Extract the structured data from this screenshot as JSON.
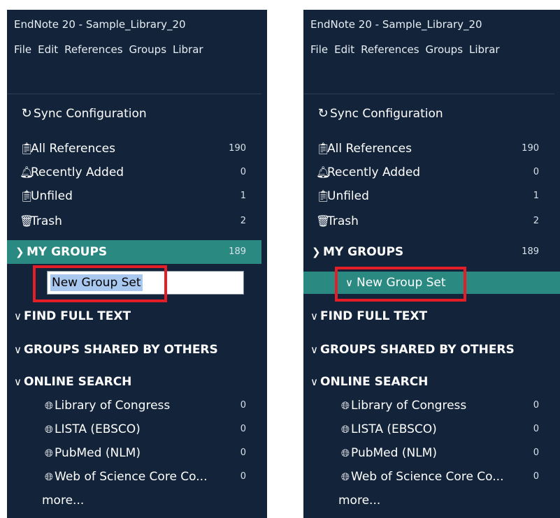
{
  "window": {
    "title": "EndNote 20 - Sample_Library_20"
  },
  "menu": {
    "left": [
      "File",
      "Edit",
      "References",
      "Groups",
      "Librar"
    ],
    "right": [
      "File",
      "Edit",
      "References",
      "Groups",
      "Librar"
    ]
  },
  "sidebar": {
    "sync_label": "Sync Configuration",
    "all_references": {
      "label": "All References",
      "count": "190"
    },
    "recently_added": {
      "label": "Recently Added",
      "count": "0"
    },
    "unfiled": {
      "label": "Unfiled",
      "count": "1"
    },
    "trash": {
      "label": "Trash",
      "count": "2"
    },
    "my_groups": {
      "label": "MY GROUPS",
      "count": "189"
    },
    "new_group_set": "New Group Set",
    "find_full_text": "FIND FULL TEXT",
    "groups_shared": "GROUPS SHARED BY OTHERS",
    "online_search": "ONLINE SEARCH",
    "online_items": [
      {
        "label": "Library of Congress",
        "count": "0"
      },
      {
        "label": "LISTA (EBSCO)",
        "count": "0"
      },
      {
        "label": "PubMed (NLM)",
        "count": "0"
      },
      {
        "label": "Web of Science Core Co...",
        "count": "0"
      }
    ],
    "more": "more..."
  },
  "colors": {
    "sidebar_bg": "#12233a",
    "selected_row": "#2a8a82",
    "highlight_box": "#e41e26"
  },
  "icons": {
    "sync": "sync-icon",
    "references": "clipboard-icon",
    "recent": "bell-icon",
    "unfiled": "clipboard-icon",
    "trash": "trash-icon",
    "online": "globe-icon"
  }
}
